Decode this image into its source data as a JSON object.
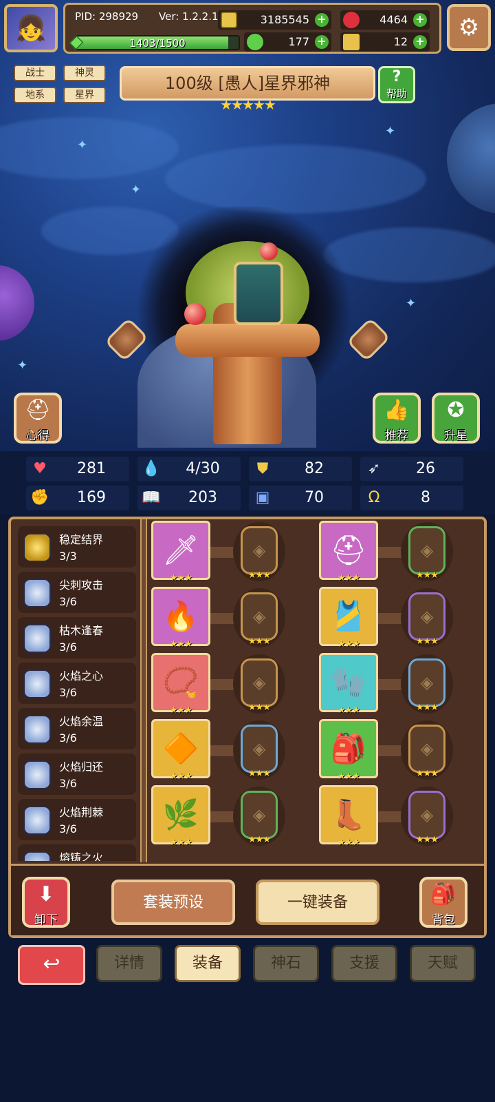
{
  "player": {
    "pid": "PID: 298929",
    "version": "Ver: 1.2.2.1",
    "exp_text": "1403/1500",
    "exp_progress": 0.935
  },
  "resources": {
    "gold": "3185545",
    "ruby": "4464",
    "clover": "177",
    "key": "12"
  },
  "tags": [
    "战士",
    "神灵",
    "地系",
    "星界"
  ],
  "hero": {
    "title": "100级 [愚人]星界邪神",
    "stars": "★★★★★",
    "star_count": 5
  },
  "buttons": {
    "help": "帮助",
    "insight": "心得",
    "recommend": "推荐",
    "upgrade_star": "升星",
    "unequip": "卸下",
    "preset": "套装预设",
    "auto_equip": "一键装备",
    "backpack": "背包"
  },
  "stats": [
    "281",
    "4/30",
    "82",
    "26",
    "169",
    "203",
    "70",
    "8"
  ],
  "sets": [
    {
      "name": "稳定结界",
      "count": "3/3"
    },
    {
      "name": "尖刺攻击",
      "count": "3/6"
    },
    {
      "name": "枯木逢春",
      "count": "3/6"
    },
    {
      "name": "火焰之心",
      "count": "3/6"
    },
    {
      "name": "火焰余温",
      "count": "3/6"
    },
    {
      "name": "火焰归还",
      "count": "3/6"
    },
    {
      "name": "火焰荆棘",
      "count": "3/6"
    },
    {
      "name": "熔铸之火",
      "count": ""
    }
  ],
  "equipment_stars": "★★★",
  "nav": {
    "details": "详情",
    "equip": "装备",
    "godstone": "神石",
    "support": "支援",
    "talent": "天赋"
  },
  "colors": {
    "accent_green": "#49b334",
    "panel_brown": "#4b2f22",
    "border_gold": "#c79a63",
    "star_yellow": "#ffd33a",
    "back_red": "#e2474b"
  }
}
